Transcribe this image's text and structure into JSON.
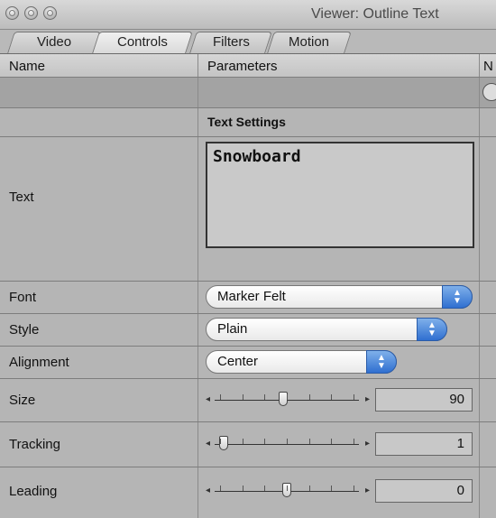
{
  "window": {
    "title": "Viewer: Outline Text"
  },
  "tabs": [
    {
      "label": "Video"
    },
    {
      "label": "Controls"
    },
    {
      "label": "Filters"
    },
    {
      "label": "Motion"
    }
  ],
  "header": {
    "name": "Name",
    "parameters": "Parameters",
    "extra": "N"
  },
  "section": {
    "title": "Text Settings"
  },
  "rows": {
    "text": {
      "label": "Text",
      "value": "Snowboard"
    },
    "font": {
      "label": "Font",
      "value": "Marker Felt"
    },
    "style": {
      "label": "Style",
      "value": "Plain"
    },
    "alignment": {
      "label": "Alignment",
      "value": "Center"
    },
    "size": {
      "label": "Size",
      "value": "90",
      "slider_fraction": 0.47
    },
    "tracking": {
      "label": "Tracking",
      "value": "1",
      "slider_fraction": 0.03
    },
    "leading": {
      "label": "Leading",
      "value": "0",
      "slider_fraction": 0.5
    }
  },
  "icons": {
    "close": "close-icon",
    "minimize": "minimize-icon",
    "zoom": "zoom-icon",
    "popup_arrows": "updown-arrows-icon",
    "reset": "reset-icon"
  }
}
